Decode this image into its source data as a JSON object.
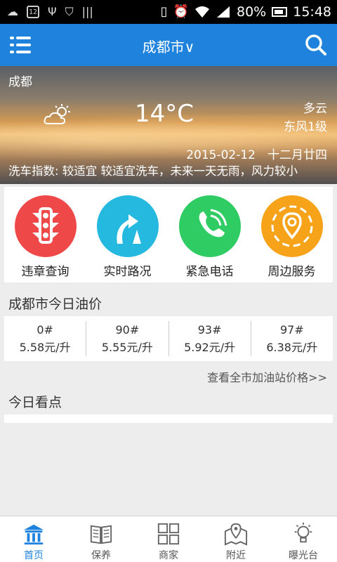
{
  "statusbar": {
    "notif_box": "12",
    "battery": "80%",
    "time": "15:48"
  },
  "header": {
    "title": "成都市",
    "title_chevron": "∨"
  },
  "weather": {
    "city": "成都",
    "temperature": "14°C",
    "condition": "多云",
    "wind": "东风1级",
    "date_line": "2015-02-12　十二月廿四",
    "car_wash_index": "洗车指数: 较适宜 较适宜洗车，未来一天无雨，风力较小"
  },
  "services": [
    {
      "label": "违章查询",
      "color": "#ef4848",
      "icon": "traffic-light-icon"
    },
    {
      "label": "实时路况",
      "color": "#25b9e0",
      "icon": "road-cone-icon"
    },
    {
      "label": "紧急电话",
      "color": "#2fcb63",
      "icon": "phone-icon"
    },
    {
      "label": "周边服务",
      "color": "#f7a31a",
      "icon": "location-pin-icon"
    }
  ],
  "oil": {
    "title": "成都市今日油价",
    "items": [
      {
        "grade": "0#",
        "price": "5.58元/升"
      },
      {
        "grade": "90#",
        "price": "5.55元/升"
      },
      {
        "grade": "93#",
        "price": "5.92元/升"
      },
      {
        "grade": "97#",
        "price": "6.38元/升"
      }
    ],
    "link": "查看全市加油站价格>>"
  },
  "today": {
    "title": "今日看点"
  },
  "nav": [
    {
      "label": "首页",
      "icon": "home-icon",
      "active": true
    },
    {
      "label": "保养",
      "icon": "book-icon",
      "active": false
    },
    {
      "label": "商家",
      "icon": "grid-icon",
      "active": false
    },
    {
      "label": "附近",
      "icon": "map-icon",
      "active": false
    },
    {
      "label": "曝光台",
      "icon": "lightbulb-icon",
      "active": false
    }
  ],
  "colors": {
    "accent": "#1f83de",
    "statusbar": "#000000"
  }
}
